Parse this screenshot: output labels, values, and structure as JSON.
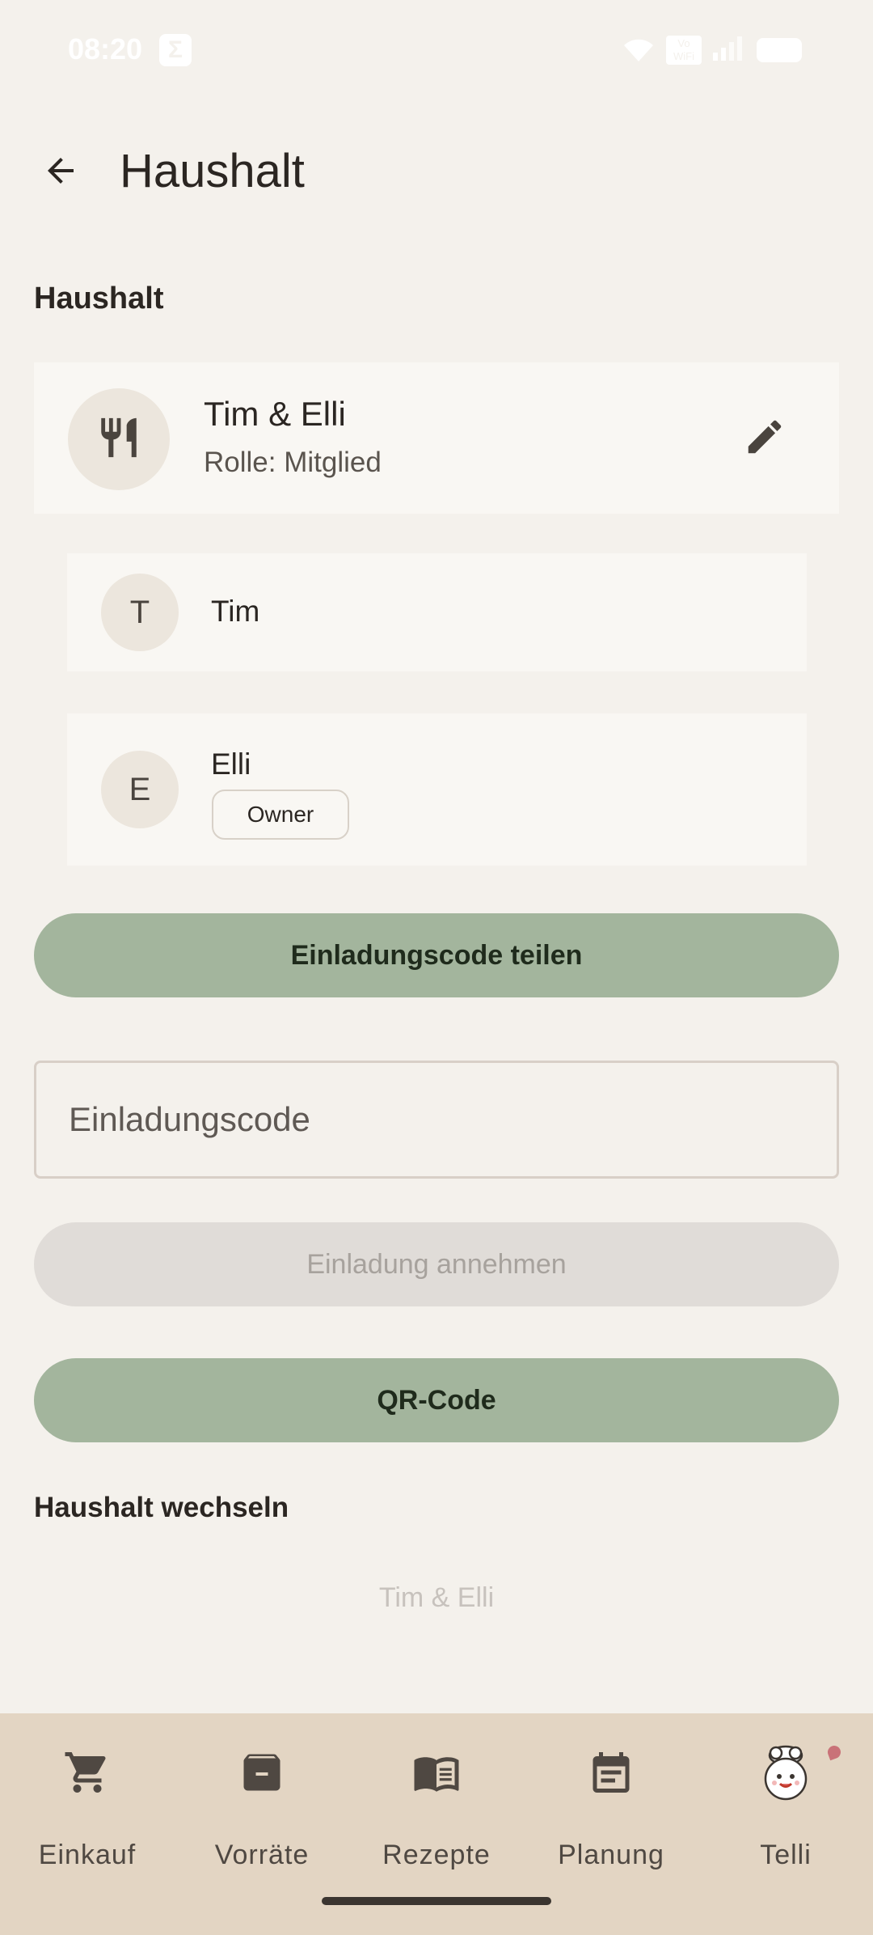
{
  "status_bar": {
    "time": "08:20",
    "app_icon": "sigma-icon",
    "volte_label": "Vo WiFi"
  },
  "app_bar": {
    "title": "Haushalt",
    "back_icon": "arrow-back-icon"
  },
  "household_section": {
    "title": "Haushalt",
    "household": {
      "name": "Tim & Elli",
      "role": "Rolle: Mitglied",
      "icon": "restaurant-icon",
      "edit_icon": "pencil-icon"
    },
    "members": [
      {
        "initial": "T",
        "name": "Tim",
        "badge": ""
      },
      {
        "initial": "E",
        "name": "Elli",
        "badge": "Owner"
      }
    ]
  },
  "actions": {
    "share_code": "Einladungscode teilen",
    "code_placeholder": "Einladungscode",
    "accept_invite": "Einladung annehmen",
    "qr_code": "QR-Code"
  },
  "switch_section": {
    "title": "Haushalt wechseln",
    "items": [
      "Tim & Elli"
    ]
  },
  "bottom_nav": {
    "items": [
      {
        "label": "Einkauf",
        "icon": "shopping-cart-icon"
      },
      {
        "label": "Vorräte",
        "icon": "archive-box-icon"
      },
      {
        "label": "Rezepte",
        "icon": "open-book-icon"
      },
      {
        "label": "Planung",
        "icon": "calendar-icon"
      },
      {
        "label": "Telli",
        "icon": "chef-mascot-icon"
      }
    ]
  },
  "colors": {
    "background": "#f4f1ec",
    "card": "#f9f7f3",
    "primary_button": "#a3b59d",
    "disabled_button": "#e0dcd8",
    "bottom_nav": "#e3d5c3"
  }
}
